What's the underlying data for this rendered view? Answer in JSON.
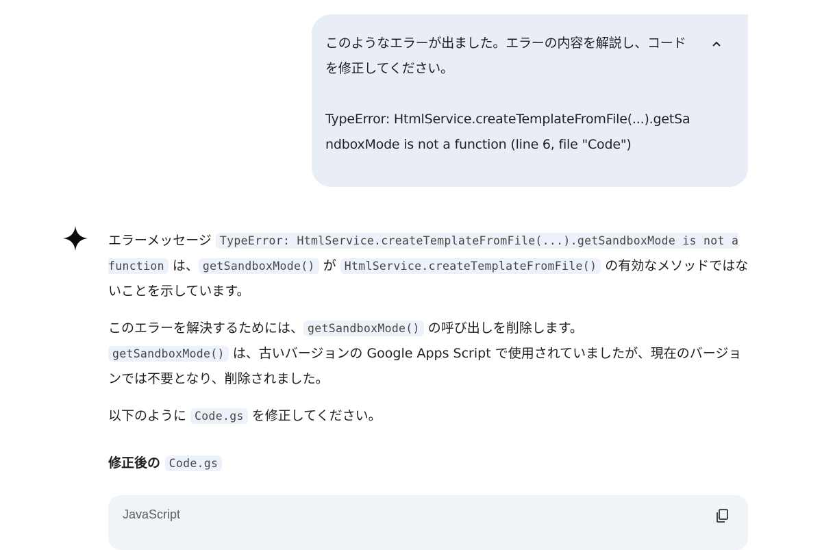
{
  "user_message": {
    "line1": "このようなエラーが出ました。エラーの内容を解説し、コードを修正してください。",
    "line2": "TypeError: HtmlService.createTemplateFromFile(...).getSandboxMode is not a function (line 6, file \"Code\")"
  },
  "response": {
    "p1": {
      "t1": "エラーメッセージ ",
      "c1": "TypeError: HtmlService.createTemplateFromFile(...).getSandboxMode is not a function",
      "t2": " は、",
      "c2": "getSandboxMode()",
      "t3": " が ",
      "c3": "HtmlService.createTemplateFromFile()",
      "t4": " の有効なメソッドではないことを示しています。"
    },
    "p2": {
      "t1": "このエラーを解決するためには、",
      "c1": "getSandboxMode()",
      "t2": " の呼び出しを削除します。"
    },
    "p3": {
      "c1": "getSandboxMode()",
      "t1": " は、古いバージョンの Google Apps Script で使用されていましたが、現在のバージョンでは不要となり、削除されました。"
    },
    "p4": {
      "t1": "以下のように ",
      "c1": "Code.gs",
      "t2": " を修正してください。"
    },
    "heading": {
      "t1": "修正後の ",
      "c1": "Code.gs"
    }
  },
  "code_block": {
    "language": "JavaScript"
  },
  "icons": {
    "collapse": "chevron-up-icon",
    "assistant": "sparkle-icon",
    "copy": "copy-icon"
  }
}
